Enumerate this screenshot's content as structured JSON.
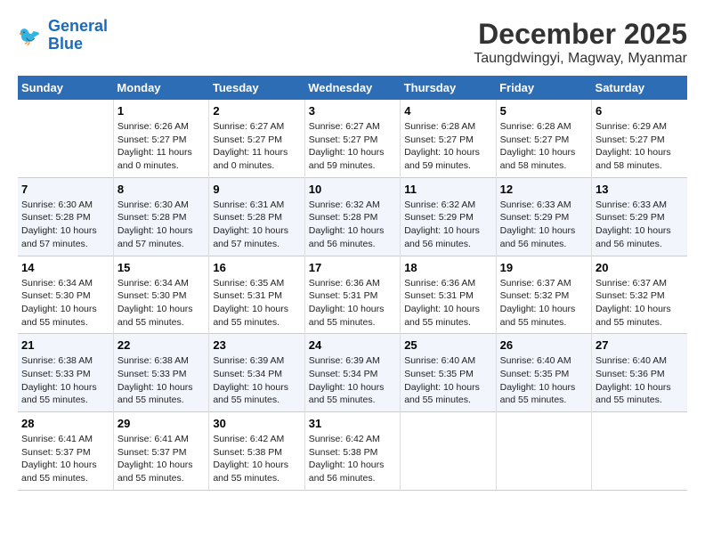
{
  "header": {
    "logo_line1": "General",
    "logo_line2": "Blue",
    "month": "December 2025",
    "location": "Taungdwingyi, Magway, Myanmar"
  },
  "days_of_week": [
    "Sunday",
    "Monday",
    "Tuesday",
    "Wednesday",
    "Thursday",
    "Friday",
    "Saturday"
  ],
  "weeks": [
    [
      {
        "day": "",
        "info": ""
      },
      {
        "day": "1",
        "info": "Sunrise: 6:26 AM\nSunset: 5:27 PM\nDaylight: 11 hours and 0 minutes."
      },
      {
        "day": "2",
        "info": "Sunrise: 6:27 AM\nSunset: 5:27 PM\nDaylight: 11 hours and 0 minutes."
      },
      {
        "day": "3",
        "info": "Sunrise: 6:27 AM\nSunset: 5:27 PM\nDaylight: 10 hours and 59 minutes."
      },
      {
        "day": "4",
        "info": "Sunrise: 6:28 AM\nSunset: 5:27 PM\nDaylight: 10 hours and 59 minutes."
      },
      {
        "day": "5",
        "info": "Sunrise: 6:28 AM\nSunset: 5:27 PM\nDaylight: 10 hours and 58 minutes."
      },
      {
        "day": "6",
        "info": "Sunrise: 6:29 AM\nSunset: 5:27 PM\nDaylight: 10 hours and 58 minutes."
      }
    ],
    [
      {
        "day": "7",
        "info": "Sunrise: 6:30 AM\nSunset: 5:28 PM\nDaylight: 10 hours and 57 minutes."
      },
      {
        "day": "8",
        "info": "Sunrise: 6:30 AM\nSunset: 5:28 PM\nDaylight: 10 hours and 57 minutes."
      },
      {
        "day": "9",
        "info": "Sunrise: 6:31 AM\nSunset: 5:28 PM\nDaylight: 10 hours and 57 minutes."
      },
      {
        "day": "10",
        "info": "Sunrise: 6:32 AM\nSunset: 5:28 PM\nDaylight: 10 hours and 56 minutes."
      },
      {
        "day": "11",
        "info": "Sunrise: 6:32 AM\nSunset: 5:29 PM\nDaylight: 10 hours and 56 minutes."
      },
      {
        "day": "12",
        "info": "Sunrise: 6:33 AM\nSunset: 5:29 PM\nDaylight: 10 hours and 56 minutes."
      },
      {
        "day": "13",
        "info": "Sunrise: 6:33 AM\nSunset: 5:29 PM\nDaylight: 10 hours and 56 minutes."
      }
    ],
    [
      {
        "day": "14",
        "info": "Sunrise: 6:34 AM\nSunset: 5:30 PM\nDaylight: 10 hours and 55 minutes."
      },
      {
        "day": "15",
        "info": "Sunrise: 6:34 AM\nSunset: 5:30 PM\nDaylight: 10 hours and 55 minutes."
      },
      {
        "day": "16",
        "info": "Sunrise: 6:35 AM\nSunset: 5:31 PM\nDaylight: 10 hours and 55 minutes."
      },
      {
        "day": "17",
        "info": "Sunrise: 6:36 AM\nSunset: 5:31 PM\nDaylight: 10 hours and 55 minutes."
      },
      {
        "day": "18",
        "info": "Sunrise: 6:36 AM\nSunset: 5:31 PM\nDaylight: 10 hours and 55 minutes."
      },
      {
        "day": "19",
        "info": "Sunrise: 6:37 AM\nSunset: 5:32 PM\nDaylight: 10 hours and 55 minutes."
      },
      {
        "day": "20",
        "info": "Sunrise: 6:37 AM\nSunset: 5:32 PM\nDaylight: 10 hours and 55 minutes."
      }
    ],
    [
      {
        "day": "21",
        "info": "Sunrise: 6:38 AM\nSunset: 5:33 PM\nDaylight: 10 hours and 55 minutes."
      },
      {
        "day": "22",
        "info": "Sunrise: 6:38 AM\nSunset: 5:33 PM\nDaylight: 10 hours and 55 minutes."
      },
      {
        "day": "23",
        "info": "Sunrise: 6:39 AM\nSunset: 5:34 PM\nDaylight: 10 hours and 55 minutes."
      },
      {
        "day": "24",
        "info": "Sunrise: 6:39 AM\nSunset: 5:34 PM\nDaylight: 10 hours and 55 minutes."
      },
      {
        "day": "25",
        "info": "Sunrise: 6:40 AM\nSunset: 5:35 PM\nDaylight: 10 hours and 55 minutes."
      },
      {
        "day": "26",
        "info": "Sunrise: 6:40 AM\nSunset: 5:35 PM\nDaylight: 10 hours and 55 minutes."
      },
      {
        "day": "27",
        "info": "Sunrise: 6:40 AM\nSunset: 5:36 PM\nDaylight: 10 hours and 55 minutes."
      }
    ],
    [
      {
        "day": "28",
        "info": "Sunrise: 6:41 AM\nSunset: 5:37 PM\nDaylight: 10 hours and 55 minutes."
      },
      {
        "day": "29",
        "info": "Sunrise: 6:41 AM\nSunset: 5:37 PM\nDaylight: 10 hours and 55 minutes."
      },
      {
        "day": "30",
        "info": "Sunrise: 6:42 AM\nSunset: 5:38 PM\nDaylight: 10 hours and 55 minutes."
      },
      {
        "day": "31",
        "info": "Sunrise: 6:42 AM\nSunset: 5:38 PM\nDaylight: 10 hours and 56 minutes."
      },
      {
        "day": "",
        "info": ""
      },
      {
        "day": "",
        "info": ""
      },
      {
        "day": "",
        "info": ""
      }
    ]
  ]
}
